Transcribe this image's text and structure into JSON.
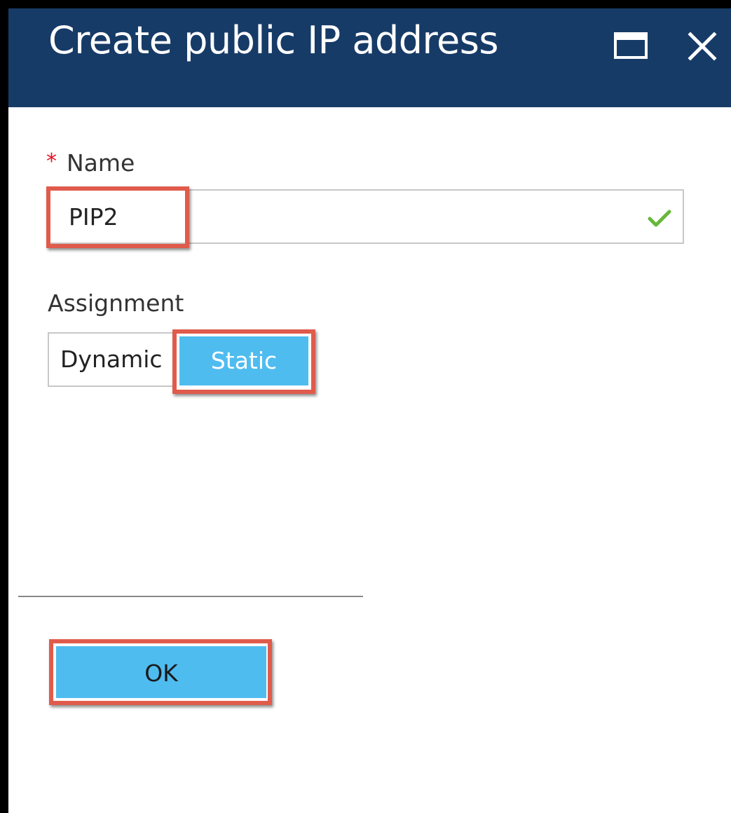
{
  "blade": {
    "title": "Create public IP address",
    "maximize_icon": "maximize-icon",
    "close_icon": "close-icon"
  },
  "name_field": {
    "required_marker": "*",
    "label": "Name",
    "value": "PIP2",
    "valid_icon": "checkmark-icon"
  },
  "assignment": {
    "label": "Assignment",
    "options": [
      "Dynamic",
      "Static"
    ],
    "selected": "Static"
  },
  "actions": {
    "ok_label": "OK"
  },
  "colors": {
    "header": "#173b67",
    "accent": "#4fbcf0",
    "highlight": "#e05b4b",
    "required": "#e81123",
    "valid": "#68b73a"
  }
}
